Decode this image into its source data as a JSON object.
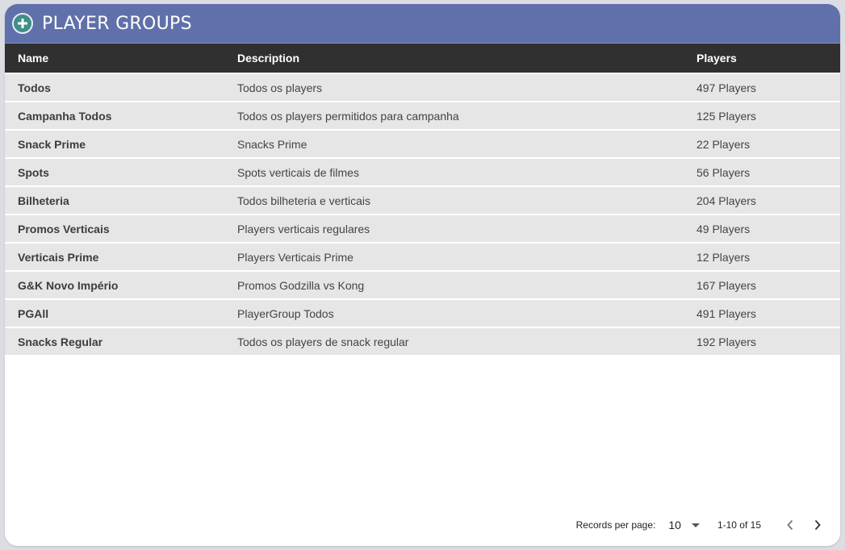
{
  "header": {
    "title": "PLAYER GROUPS",
    "add_icon": "plus-circle-icon",
    "color": "#6070aa"
  },
  "table": {
    "columns": [
      "Name",
      "Description",
      "Players"
    ],
    "rows": [
      {
        "name": "Todos",
        "description": "Todos os players",
        "players": "497 Players"
      },
      {
        "name": "Campanha Todos",
        "description": "Todos os players permitidos para campanha",
        "players": "125 Players"
      },
      {
        "name": "Snack Prime",
        "description": "Snacks Prime",
        "players": "22 Players"
      },
      {
        "name": "Spots",
        "description": "Spots verticais de filmes",
        "players": "56 Players"
      },
      {
        "name": "Bilheteria",
        "description": "Todos bilheteria e verticais",
        "players": "204 Players"
      },
      {
        "name": "Promos Verticais",
        "description": "Players verticais regulares",
        "players": "49 Players"
      },
      {
        "name": "Verticais Prime",
        "description": "Players Verticais Prime",
        "players": "12 Players"
      },
      {
        "name": "G&K Novo Império",
        "description": "Promos Godzilla vs Kong",
        "players": "167 Players"
      },
      {
        "name": "PGAll",
        "description": "PlayerGroup Todos",
        "players": "491 Players"
      },
      {
        "name": "Snacks Regular",
        "description": "Todos os players de snack regular",
        "players": "192 Players"
      }
    ]
  },
  "pagination": {
    "records_label": "Records per page:",
    "records_value": "10",
    "range": "1-10 of 15",
    "prev_icon": "chevron-left-icon",
    "next_icon": "chevron-right-icon"
  }
}
